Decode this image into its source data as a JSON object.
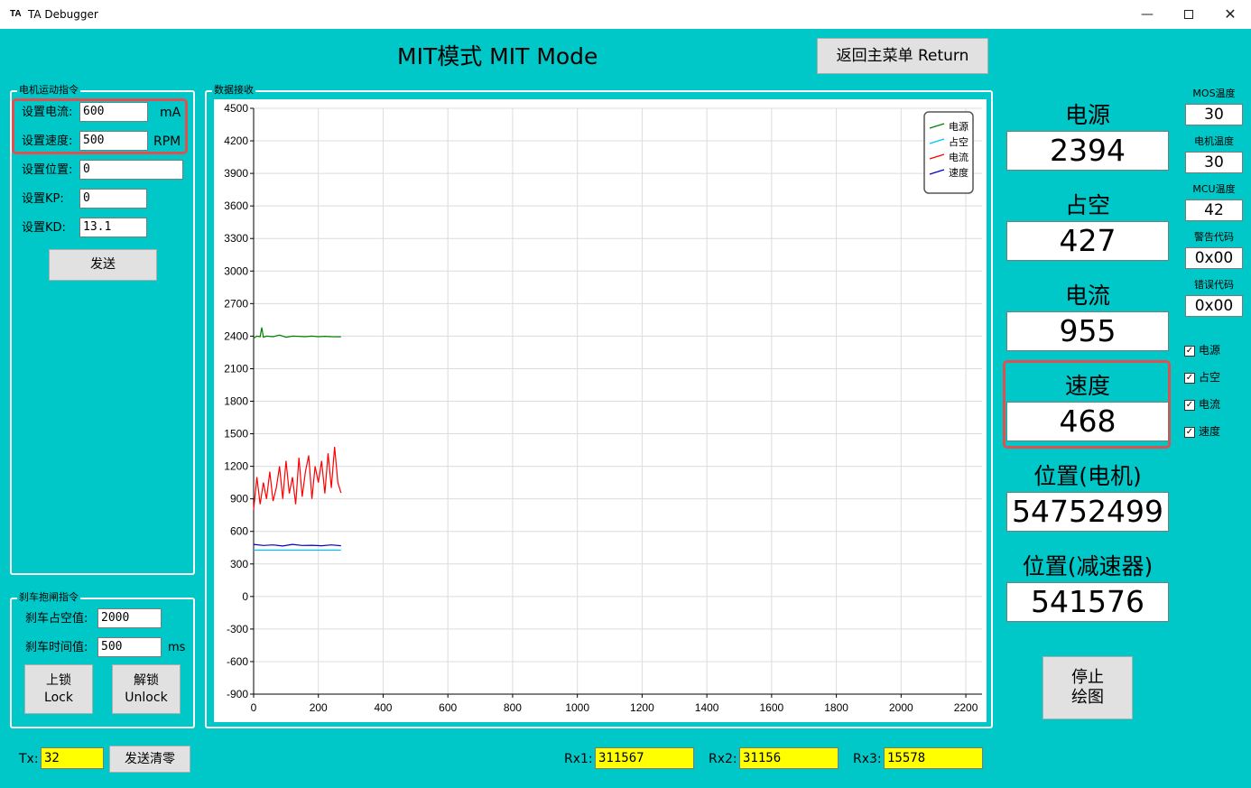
{
  "window": {
    "icon_text": "TA",
    "title": "TA Debugger",
    "min_symbol": "—",
    "close_symbol": "✕"
  },
  "header": {
    "title": "MIT模式 MIT Mode",
    "return_label": "返回主菜单 Return"
  },
  "motion": {
    "legend": "电机运动指令",
    "current_label": "设置电流:",
    "current_value": "600",
    "current_unit": "mA",
    "speed_label": "设置速度:",
    "speed_value": "500",
    "speed_unit": "RPM",
    "position_label": "设置位置:",
    "position_value": "0",
    "kp_label": "设置KP:",
    "kp_value": "0",
    "kd_label": "设置KD:",
    "kd_value": "13.1",
    "send_label": "发送"
  },
  "brake": {
    "legend": "刹车抱闸指令",
    "duty_label": "刹车占空值:",
    "duty_value": "2000",
    "time_label": "刹车时间值:",
    "time_value": "500",
    "time_unit": "ms",
    "lock_line1": "上锁",
    "lock_line2": "Lock",
    "unlock_line1": "解锁",
    "unlock_line2": "Unlock"
  },
  "data_group": {
    "legend": "数据接收"
  },
  "status_bar": {
    "tx_label": "Tx:",
    "tx_value": "32",
    "clear_label": "发送清零",
    "rx1_label": "Rx1:",
    "rx1_value": "311567",
    "rx2_label": "Rx2:",
    "rx2_value": "31156",
    "rx3_label": "Rx3:",
    "rx3_value": "15578"
  },
  "readouts": {
    "power_label": "电源",
    "power_value": "2394",
    "duty_label": "占空",
    "duty_value": "427",
    "current_label": "电流",
    "current_value": "955",
    "speed_label": "速度",
    "speed_value": "468",
    "pos_motor_label": "位置(电机)",
    "pos_motor_value": "54752499",
    "pos_reducer_label": "位置(减速器)",
    "pos_reducer_value": "541576",
    "stop_line1": "停止",
    "stop_line2": "绘图"
  },
  "status": {
    "mos_temp_label": "MOS温度",
    "mos_temp_value": "30",
    "motor_temp_label": "电机温度",
    "motor_temp_value": "30",
    "mcu_temp_label": "MCU温度",
    "mcu_temp_value": "42",
    "warn_label": "警告代码",
    "warn_value": "0x00",
    "error_label": "错误代码",
    "error_value": "0x00"
  },
  "toggles": [
    {
      "label": "电源",
      "checked": true
    },
    {
      "label": "占空",
      "checked": true
    },
    {
      "label": "电流",
      "checked": true
    },
    {
      "label": "速度",
      "checked": true
    }
  ],
  "chart_data": {
    "type": "line",
    "xlim": [
      0,
      2250
    ],
    "ylim": [
      -900,
      4500
    ],
    "x_ticks": [
      0,
      200,
      400,
      600,
      800,
      1000,
      1200,
      1400,
      1600,
      1800,
      2000,
      2200
    ],
    "y_ticks": [
      4500,
      4200,
      3900,
      3600,
      3300,
      3000,
      2700,
      2400,
      2100,
      1800,
      1500,
      1200,
      900,
      600,
      300,
      0,
      -300,
      -600,
      -900
    ],
    "grid": true,
    "legend_position": "top-right",
    "series": [
      {
        "name": "电源",
        "color": "#008000",
        "x": [
          0,
          10,
          20,
          25,
          30,
          40,
          60,
          80,
          100,
          120,
          140,
          160,
          180,
          200,
          220,
          240,
          270
        ],
        "y": [
          2380,
          2400,
          2395,
          2480,
          2390,
          2400,
          2395,
          2410,
          2390,
          2400,
          2398,
          2395,
          2400,
          2395,
          2398,
          2395,
          2394
        ]
      },
      {
        "name": "占空",
        "color": "#00bfff",
        "x": [
          0,
          270
        ],
        "y": [
          427,
          427
        ]
      },
      {
        "name": "电流",
        "color": "#ff0000",
        "x": [
          0,
          10,
          20,
          30,
          40,
          50,
          60,
          70,
          80,
          90,
          100,
          110,
          120,
          130,
          140,
          150,
          160,
          170,
          180,
          190,
          200,
          210,
          220,
          230,
          240,
          250,
          260,
          270
        ],
        "y": [
          800,
          1100,
          850,
          1050,
          900,
          1150,
          880,
          1000,
          1200,
          900,
          1250,
          950,
          1100,
          850,
          1280,
          920,
          1150,
          1300,
          900,
          1200,
          1050,
          1250,
          950,
          1320,
          1000,
          1380,
          1050,
          955
        ]
      },
      {
        "name": "速度",
        "color": "#0000cc",
        "x": [
          0,
          30,
          60,
          90,
          120,
          150,
          180,
          210,
          240,
          270
        ],
        "y": [
          480,
          470,
          475,
          465,
          480,
          470,
          472,
          468,
          475,
          468
        ]
      }
    ]
  }
}
